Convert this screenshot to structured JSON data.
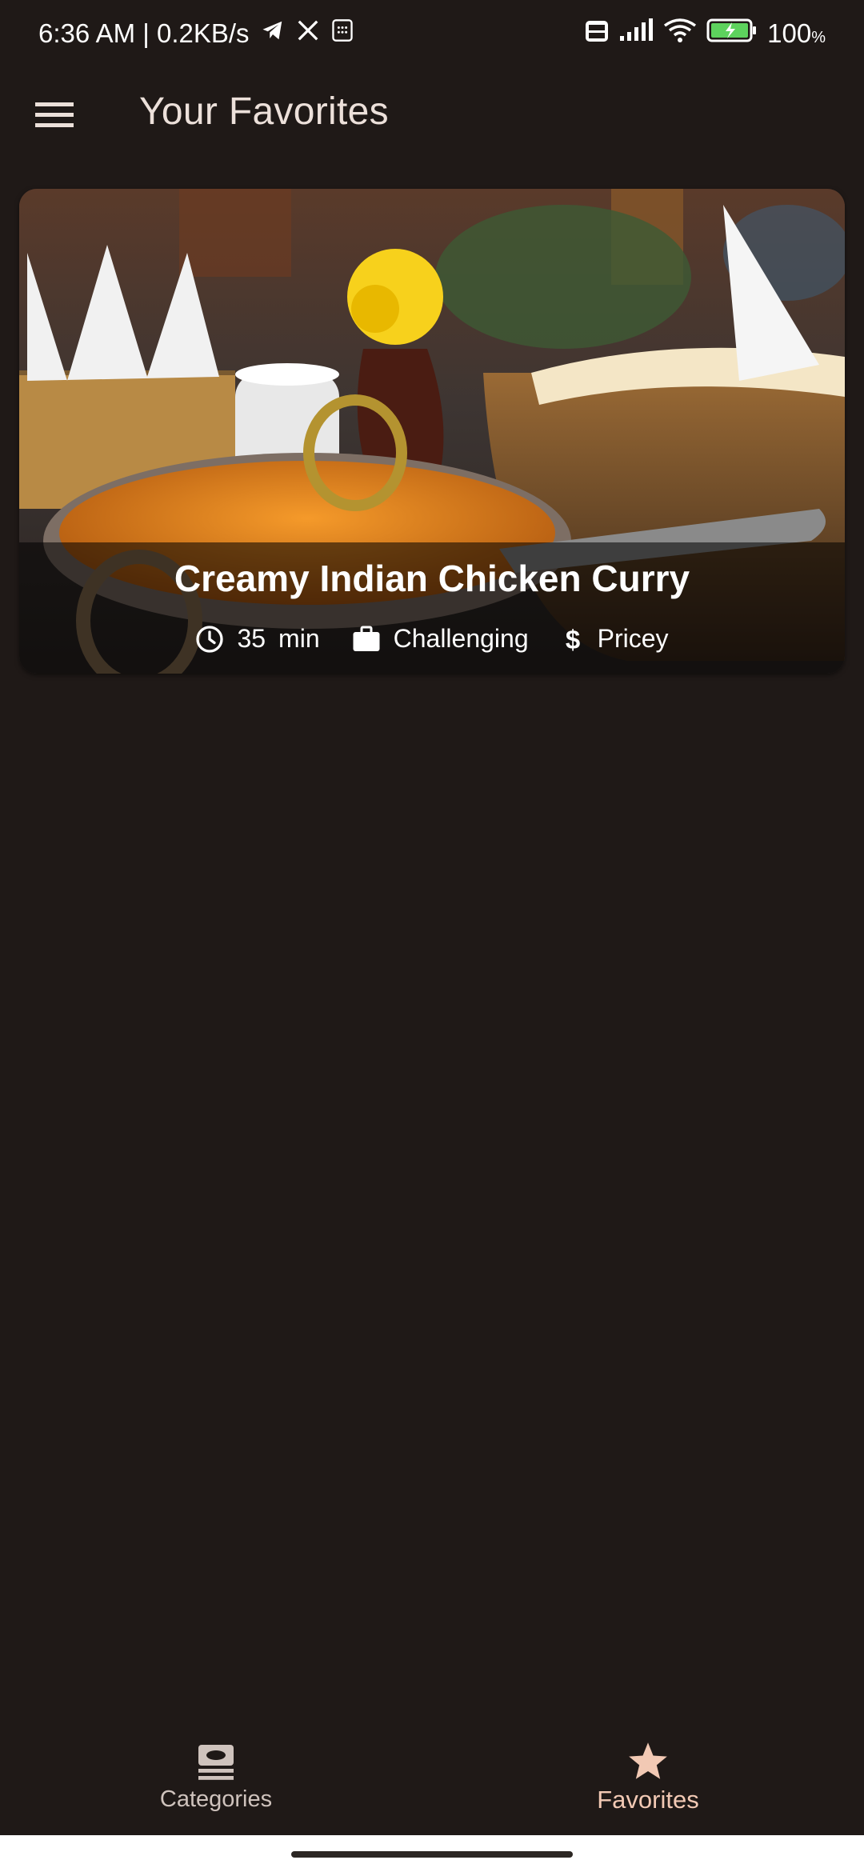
{
  "status_bar": {
    "time_speed": "6:36 AM | 0.2KB/s",
    "battery": "100",
    "battery_unit": "%"
  },
  "app_bar": {
    "title": "Your Favorites"
  },
  "meal": {
    "title": "Creamy Indian Chicken Curry",
    "duration_value": "35",
    "duration_unit": "min",
    "complexity": "Challenging",
    "affordability": "Pricey"
  },
  "bottom_nav": {
    "items": [
      {
        "label": "Categories",
        "icon": "set-meal-icon",
        "active": false
      },
      {
        "label": "Favorites",
        "icon": "star-icon",
        "active": true
      }
    ]
  },
  "colors": {
    "background": "#1f1917",
    "accent": "#f2c9b4",
    "text": "#ece0da"
  }
}
